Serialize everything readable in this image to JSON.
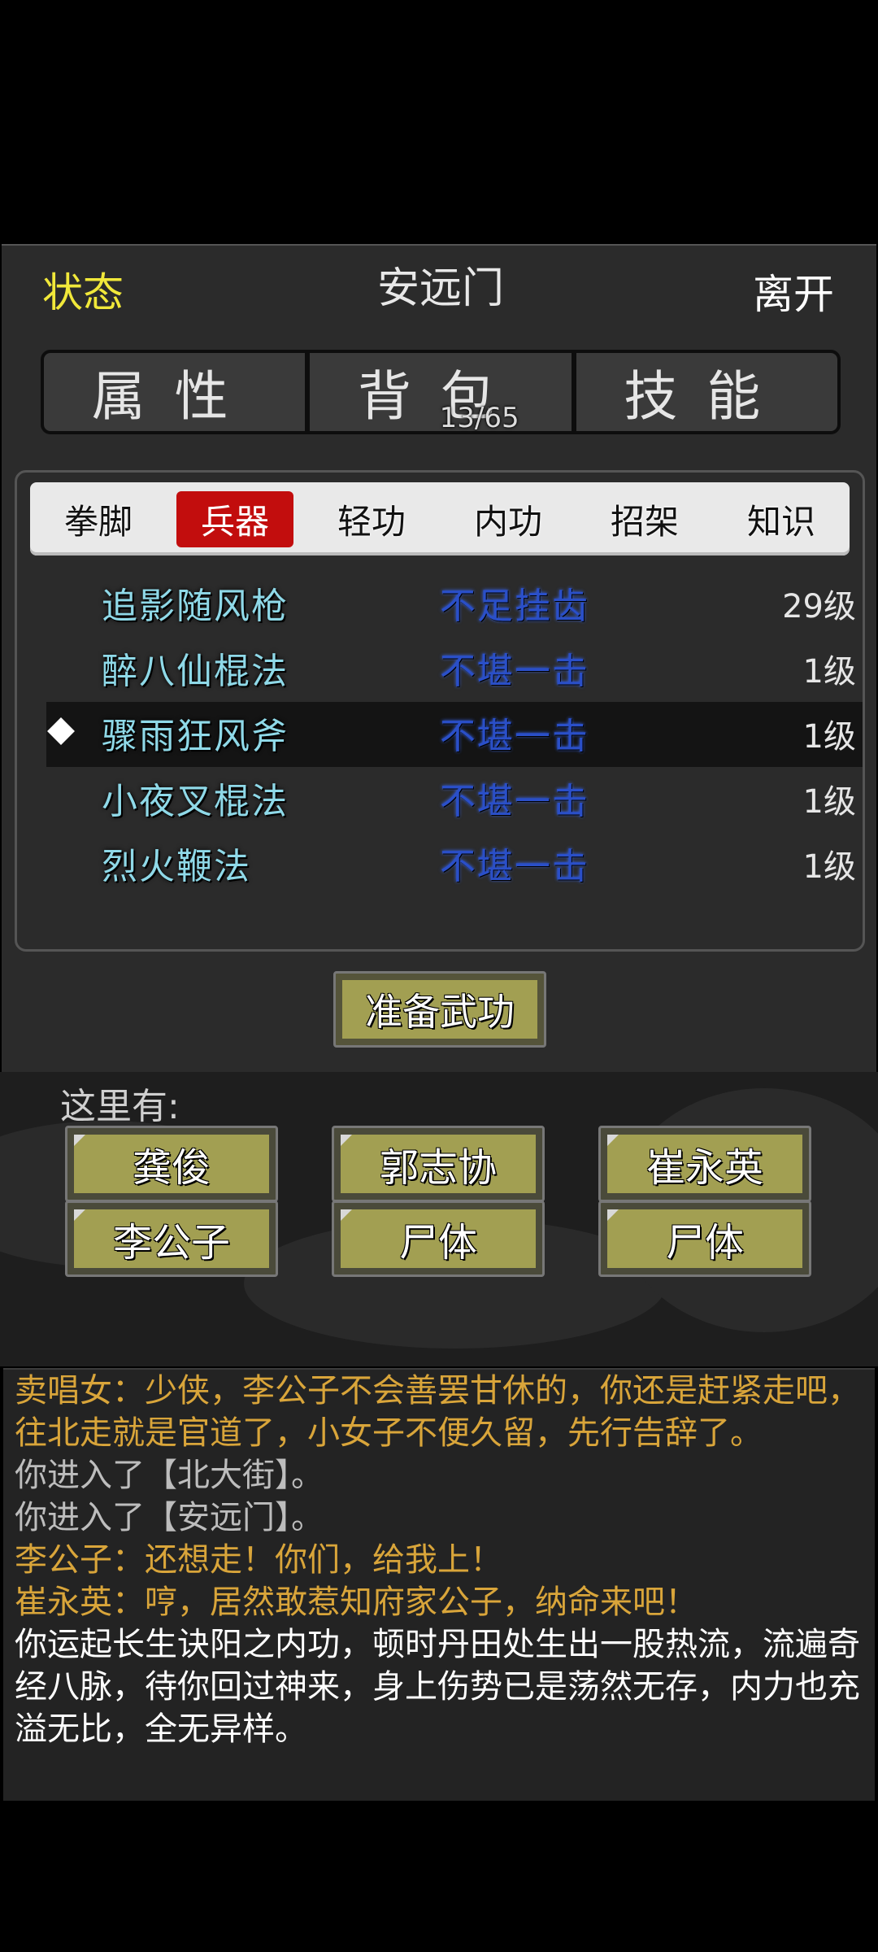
{
  "header": {
    "status_label": "状态",
    "location": "安远门",
    "leave_label": "离开"
  },
  "main_tabs": [
    {
      "label": "属性"
    },
    {
      "label": "背包",
      "count": "13/65"
    },
    {
      "label": "技能"
    }
  ],
  "sub_tabs": [
    "拳脚",
    "兵器",
    "轻功",
    "内功",
    "招架",
    "知识"
  ],
  "active_sub_tab": "兵器",
  "skills": [
    {
      "name": "",
      "grade": "",
      "level": ""
    },
    {
      "name": "追影随风枪",
      "grade": "不足挂齿",
      "level": "29级"
    },
    {
      "name": "醉八仙棍法",
      "grade": "不堪一击",
      "level": "1级"
    },
    {
      "name": "骤雨狂风斧",
      "grade": "不堪一击",
      "level": "1级",
      "selected": true
    },
    {
      "name": "小夜叉棍法",
      "grade": "不堪一击",
      "level": "1级"
    },
    {
      "name": "烈火鞭法",
      "grade": "不堪一击",
      "level": "1级"
    },
    {
      "name": "",
      "grade": "",
      "level": ""
    }
  ],
  "ready_button": "准备武功",
  "here": {
    "label": "这里有:",
    "npcs": [
      "龚俊",
      "郭志协",
      "崔永英",
      "李公子",
      "尸体",
      "尸体"
    ]
  },
  "log": [
    {
      "text": "卖唱女：少侠，李公子不会善罢甘休的，你还是赶紧走吧，往北走就是官道了，小女子不便久留，先行告辞了。",
      "color": "#d9a53a"
    },
    {
      "text": "你进入了【北大街】。",
      "color": "#bdbdbd"
    },
    {
      "text": "你进入了【安远门】。",
      "color": "#bdbdbd"
    },
    {
      "text": "李公子：还想走！你们，给我上！",
      "color": "#d9a53a"
    },
    {
      "text": "崔永英：哼，居然敢惹知府家公子，纳命来吧！",
      "color": "#d9a53a"
    },
    {
      "text": "你运起长生诀阳之内功，顿时丹田处生出一股热流，流遍奇经八脉，待你回过神来，身上伤势已是荡然无存，内力也充溢无比，全无异样。",
      "color": "#ffffff"
    }
  ],
  "colors": {
    "status": "#f1e83a",
    "skill_name": "#8fd9e8",
    "grade": "#2a4fc8",
    "active_tab": "#c20d0d",
    "button": "#a29f52"
  }
}
